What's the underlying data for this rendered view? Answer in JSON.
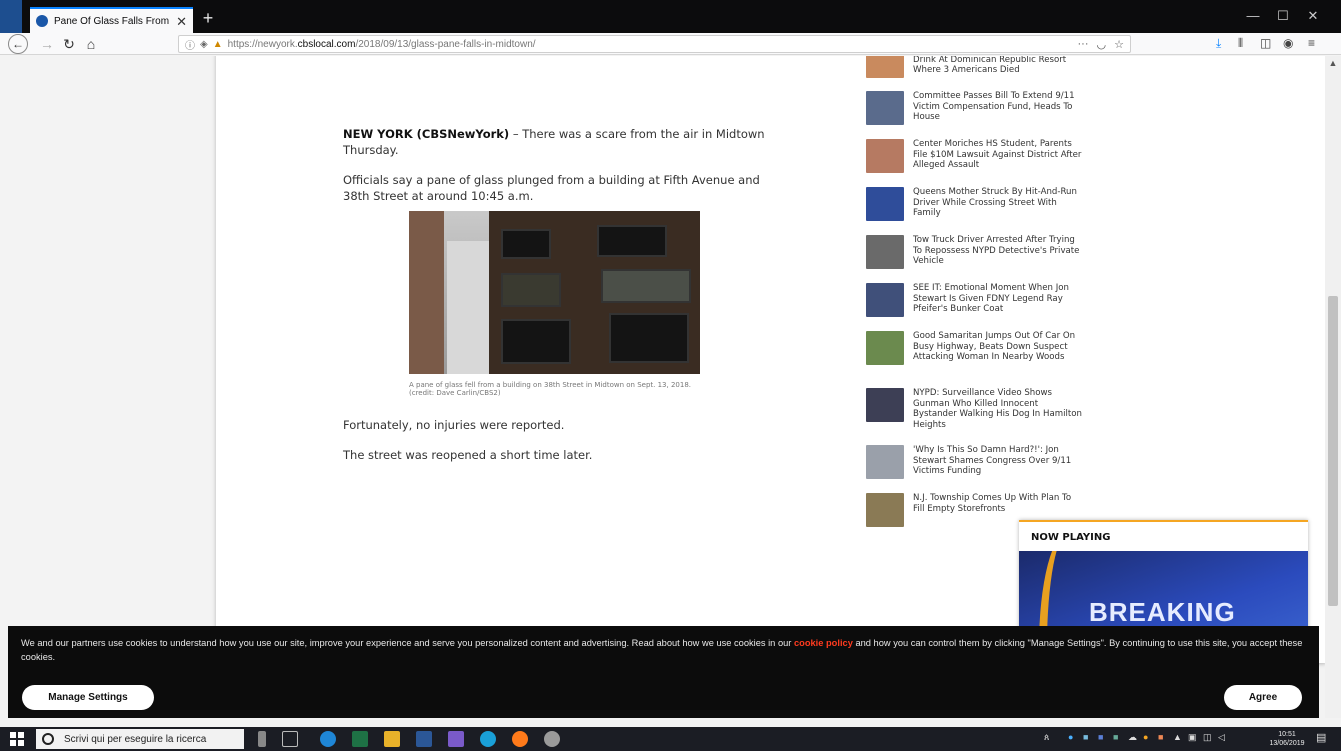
{
  "browser": {
    "tab_title": "Pane Of Glass Falls From Midto",
    "tab_close": "✕",
    "new_tab": "+",
    "url_prefix": "https://newyork.",
    "url_domain": "cbslocal.com",
    "url_path": "/2018/09/13/glass-pane-falls-in-midtown/",
    "url_more": "···",
    "window": {
      "minimize": "—",
      "maximize": "☐",
      "close": "✕"
    }
  },
  "article": {
    "dateline": "NEW YORK (CBSNewYork)",
    "lead_rest": " – There was a scare from the air in Midtown Thursday.",
    "p2": "Officials say a pane of glass plunged from a building at Fifth Avenue and 38th Street at around 10:45 a.m.",
    "caption": "A pane of glass fell from a building on 38th Street in Midtown on Sept. 13, 2018. (credit: Dave Carlin/CBS2)",
    "p3": "Fortunately, no injuries were reported.",
    "p4": "The street was reopened a short time later."
  },
  "sidebar": {
    "items": [
      {
        "text": "New York Woman Vomited Blood After Drink At Dominican Republic Resort Where 3 Americans Died",
        "color": "#c98a5e"
      },
      {
        "text": "Committee Passes Bill To Extend 9/11 Victim Compensation Fund, Heads To House",
        "color": "#5a6b8c"
      },
      {
        "text": "Center Moriches HS Student, Parents File $10M Lawsuit Against District After Alleged Assault",
        "color": "#b67a62"
      },
      {
        "text": "Queens Mother Struck By Hit-And-Run Driver While Crossing Street With Family",
        "color": "#2f4d9a"
      },
      {
        "text": "Tow Truck Driver Arrested After Trying To Repossess NYPD Detective's Private Vehicle",
        "color": "#6a6a6a"
      },
      {
        "text": "SEE IT: Emotional Moment When Jon Stewart Is Given FDNY Legend Ray Pfeifer's Bunker Coat",
        "color": "#40507a"
      },
      {
        "text": "Good Samaritan Jumps Out Of Car On Busy Highway, Beats Down Suspect Attacking Woman In Nearby Woods",
        "color": "#6b8a4e"
      },
      {
        "text": "NYPD: Surveillance Video Shows Gunman Who Killed Innocent Bystander Walking His Dog In Hamilton Heights",
        "color": "#3d3f55"
      },
      {
        "text": "'Why Is This So Damn Hard?!': Jon Stewart Shames Congress Over 9/11 Victims Funding",
        "color": "#9aa0aa"
      },
      {
        "text": "N.J. Township Comes Up With Plan To Fill Empty Storefronts",
        "color": "#8a7a55"
      }
    ]
  },
  "player": {
    "label": "NOW PLAYING",
    "video_text": "BREAKING"
  },
  "cookie": {
    "msg_before": "We and our partners use cookies to understand how you use our site, improve your experience and serve you personalized content and advertising. Read about how we use cookies in our ",
    "policy_link": "cookie policy",
    "msg_after": " and how you can control them by clicking \"Manage Settings\". By continuing to use this site, you accept these cookies.",
    "manage_label": "Manage Settings",
    "agree_label": "Agree"
  },
  "taskbar": {
    "search_placeholder": "Scrivi qui per eseguire la ricerca",
    "time": "10:51",
    "date": "13/06/2019"
  },
  "colors": {
    "accent": "#0a84ff",
    "cookie_link": "#ff3b1f",
    "player_border": "#f5a623"
  }
}
